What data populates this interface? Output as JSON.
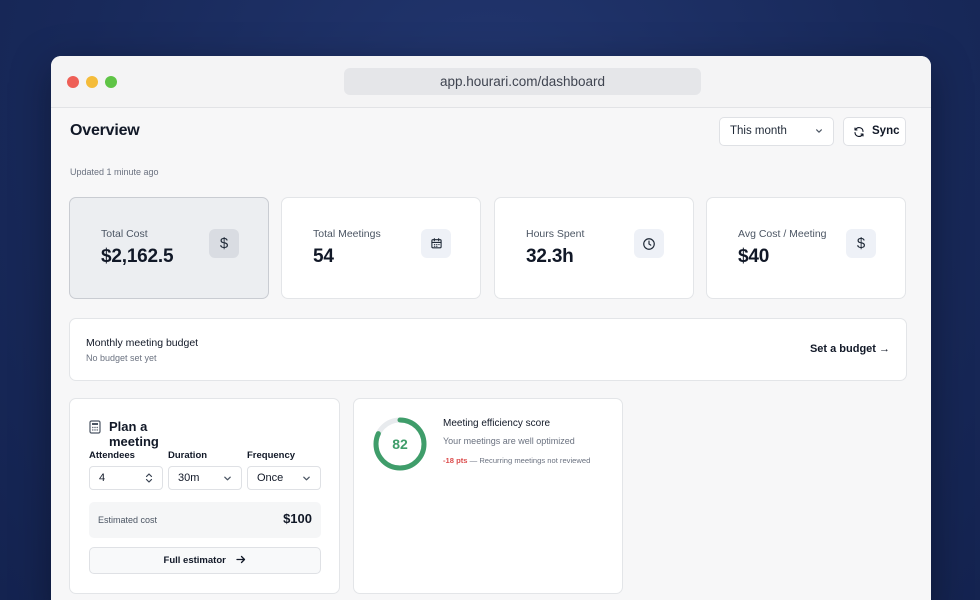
{
  "browser": {
    "url": "app.hourari.com/dashboard"
  },
  "header": {
    "title": "Overview",
    "updated": "Updated 1 minute ago",
    "period_select": "This month",
    "sync_label": "Sync"
  },
  "stats": [
    {
      "label": "Total Cost",
      "value": "$2,162.5",
      "icon": "dollar-icon"
    },
    {
      "label": "Total Meetings",
      "value": "54",
      "icon": "calendar-icon"
    },
    {
      "label": "Hours Spent",
      "value": "32.3h",
      "icon": "clock-icon"
    },
    {
      "label": "Avg Cost / Meeting",
      "value": "$40",
      "icon": "dollar-icon"
    }
  ],
  "budget": {
    "title": "Monthly meeting budget",
    "subtitle": "No budget set yet",
    "link": "Set a budget →"
  },
  "plan": {
    "title": "Plan a meeting",
    "attendees_label": "Attendees",
    "attendees_value": "4",
    "duration_label": "Duration",
    "duration_value": "30m",
    "frequency_label": "Frequency",
    "frequency_value": "Once",
    "estimate_label": "Estimated cost",
    "estimate_value": "$100",
    "button_label": "Full estimator"
  },
  "efficiency": {
    "score": "82",
    "score_fraction": 0.82,
    "title": "Meeting efficiency score",
    "subtitle": "Your meetings are well optimized",
    "delta": "-18 pts",
    "note": "— Recurring meetings not reviewed"
  },
  "colors": {
    "background": "#1b2d63",
    "accent_green": "#3f9d6a",
    "negative_red": "#dc4c4c"
  }
}
